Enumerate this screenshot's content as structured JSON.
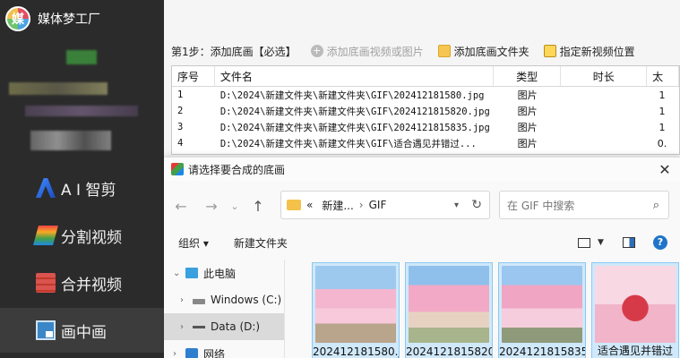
{
  "app": {
    "brand_logo_text": "媒",
    "brand_name": "媒体梦工厂"
  },
  "sidebar": {
    "items": [
      {
        "label": "A I 智剪",
        "icon": "ai-icon"
      },
      {
        "label": "分割视频",
        "icon": "split-icon"
      },
      {
        "label": "合并视频",
        "icon": "merge-icon"
      },
      {
        "label": "画中画",
        "icon": "pip-icon"
      }
    ]
  },
  "toolbar": {
    "step_label": "第1步：添加底画【必选】",
    "add_video_or_image": "添加底画视频或图片",
    "add_folder": "添加底画文件夹",
    "set_position": "指定新视频位置"
  },
  "table": {
    "headers": [
      "序号",
      "文件名",
      "类型",
      "时长",
      "太"
    ],
    "rows": [
      {
        "no": "1",
        "file": "D:\\2024\\新建文件夹\\新建文件夹\\GIF\\202412181580.jpg",
        "type": "图片",
        "duration": "",
        "extra": "1"
      },
      {
        "no": "2",
        "file": "D:\\2024\\新建文件夹\\新建文件夹\\GIF\\2024121815820.jpg",
        "type": "图片",
        "duration": "",
        "extra": "1"
      },
      {
        "no": "3",
        "file": "D:\\2024\\新建文件夹\\新建文件夹\\GIF\\2024121815835.jpg",
        "type": "图片",
        "duration": "",
        "extra": "1"
      },
      {
        "no": "4",
        "file": "D:\\2024\\新建文件夹\\新建文件夹\\GIF\\适合遇见并错过...",
        "type": "图片",
        "duration": "",
        "extra": "0."
      }
    ]
  },
  "dialog": {
    "title": "请选择要合成的底画",
    "close": "✕",
    "address": {
      "prefix": "«",
      "crumb1": "新建...",
      "crumb2": "GIF"
    },
    "search_placeholder": "在 GIF 中搜索",
    "commands": {
      "organize": "组织 ▾",
      "new_folder": "新建文件夹"
    },
    "tree": [
      {
        "label": "此电脑",
        "expanded": true
      },
      {
        "label": "Windows (C:)"
      },
      {
        "label": "Data (D:)",
        "selected": true
      },
      {
        "label": "网络"
      }
    ],
    "files": [
      {
        "name": "202412181580.j"
      },
      {
        "name": "2024121815820"
      },
      {
        "name": "2024121815835"
      },
      {
        "name": "适合遇见并错过"
      }
    ]
  }
}
